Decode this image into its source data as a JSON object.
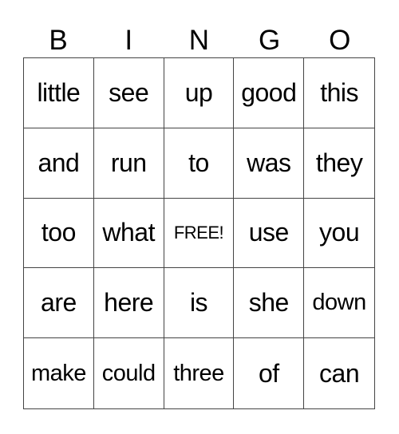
{
  "header": [
    "B",
    "I",
    "N",
    "G",
    "O"
  ],
  "cells": [
    [
      "little",
      "see",
      "up",
      "good",
      "this"
    ],
    [
      "and",
      "run",
      "to",
      "was",
      "they"
    ],
    [
      "too",
      "what",
      "FREE!",
      "use",
      "you"
    ],
    [
      "are",
      "here",
      "is",
      "she",
      "down"
    ],
    [
      "make",
      "could",
      "three",
      "of",
      "can"
    ]
  ]
}
